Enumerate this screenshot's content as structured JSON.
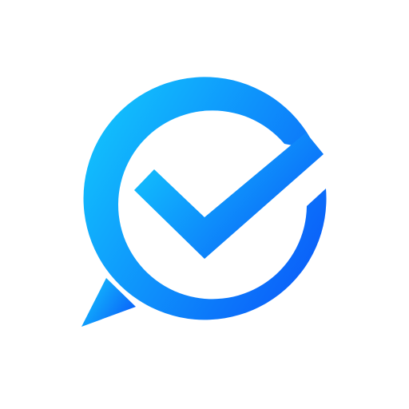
{
  "logo": {
    "name": "chat-check-logo",
    "icon": "chat-bubble-check-icon",
    "gradient_start": "#12C3FD",
    "gradient_end": "#0A5CF9",
    "background": "#FFFFFF"
  }
}
